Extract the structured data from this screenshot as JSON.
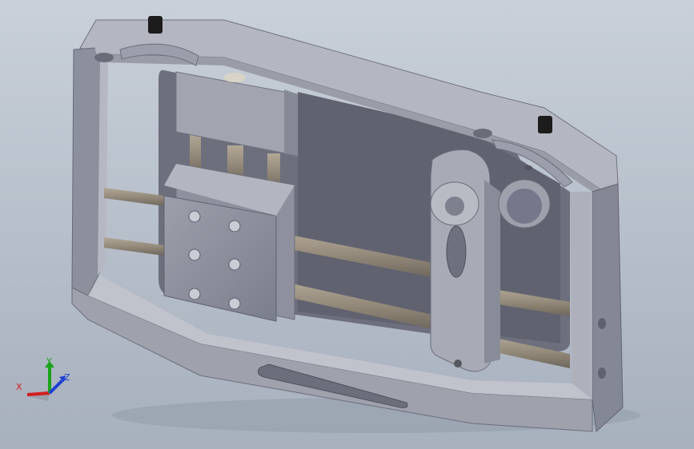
{
  "viewport": {
    "background_top": "#c9d0da",
    "background_bottom": "#a7b0bd"
  },
  "model": {
    "metal_color": "#a9acb7",
    "metal_dark": "#7c808c",
    "metal_light": "#c4c7d0",
    "rod_color": "#9a8f80",
    "screw_color": "#1d1d1d"
  },
  "triad": {
    "x_label": "X",
    "y_label": "Y",
    "z_label": "Z",
    "x_color": "#d21e1e",
    "y_color": "#1aa31a",
    "z_color": "#1e3fd2"
  }
}
